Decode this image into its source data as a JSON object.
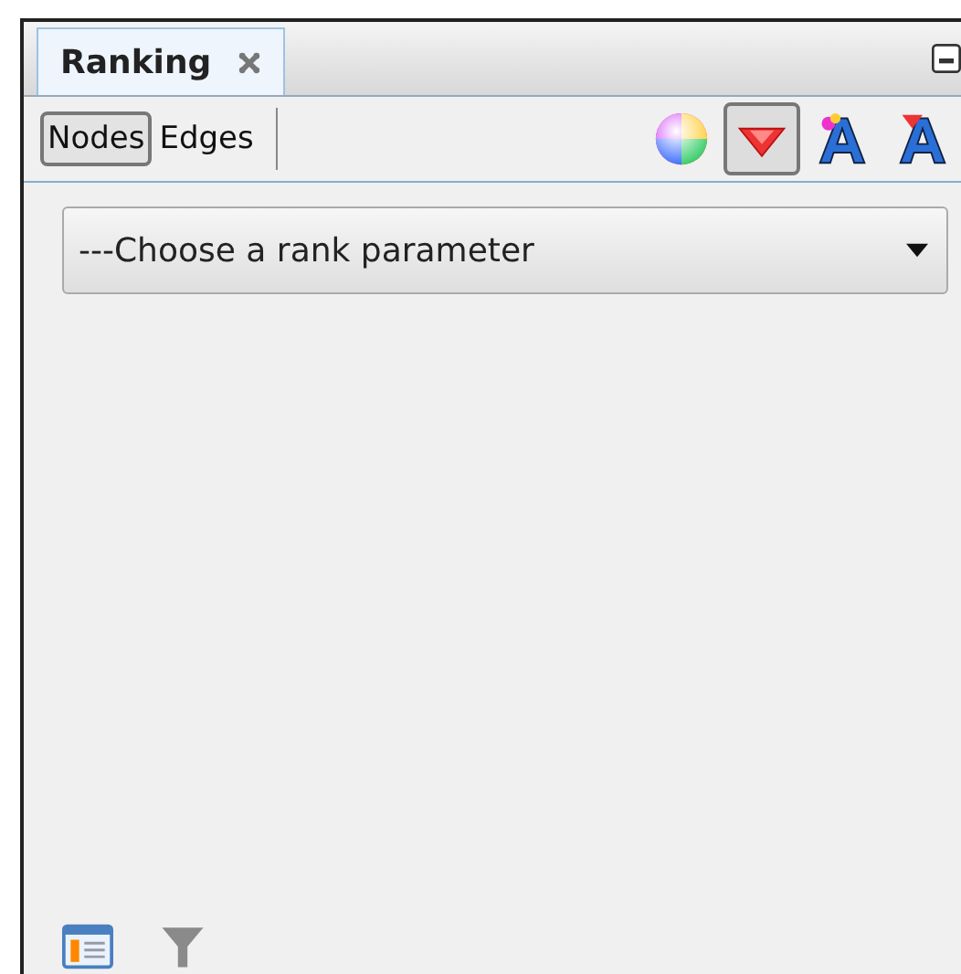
{
  "tab": {
    "title": "Ranking"
  },
  "element_toggles": [
    {
      "label": "Nodes",
      "selected": true
    },
    {
      "label": "Edges",
      "selected": false
    }
  ],
  "tools": [
    {
      "kind": "color",
      "selected": false
    },
    {
      "kind": "size",
      "selected": true
    },
    {
      "kind": "label-color",
      "selected": false
    },
    {
      "kind": "label-size",
      "selected": false
    }
  ],
  "rank_dropdown": {
    "value": "---Choose a rank parameter"
  }
}
